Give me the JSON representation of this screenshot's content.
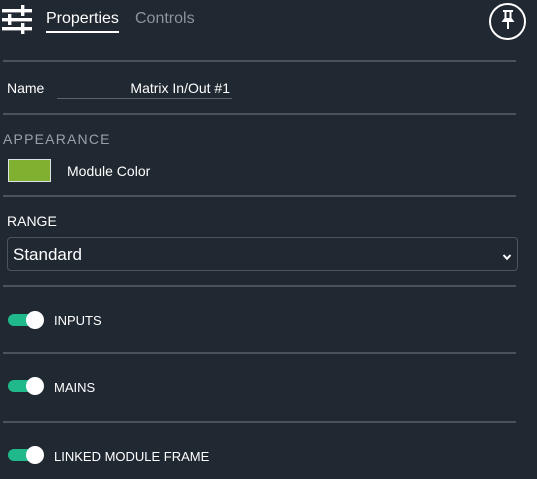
{
  "header": {
    "tabs": [
      {
        "label": "Properties",
        "active": true
      },
      {
        "label": "Controls",
        "active": false
      }
    ],
    "settings_icon": "sliders-icon",
    "pin_icon": "pin-icon"
  },
  "name": {
    "label": "Name",
    "value": "Matrix In/Out #1"
  },
  "appearance": {
    "heading": "APPEARANCE",
    "color_label": "Module Color",
    "color": "#7fb030"
  },
  "range": {
    "label": "RANGE",
    "selected": "Standard"
  },
  "toggles": [
    {
      "label": "INPUTS",
      "on": true
    },
    {
      "label": "MAINS",
      "on": true
    },
    {
      "label": "LINKED MODULE FRAME",
      "on": true
    }
  ],
  "colors": {
    "background": "#202832",
    "accent_toggle": "#1fb98c",
    "divider": "#4a525b"
  }
}
